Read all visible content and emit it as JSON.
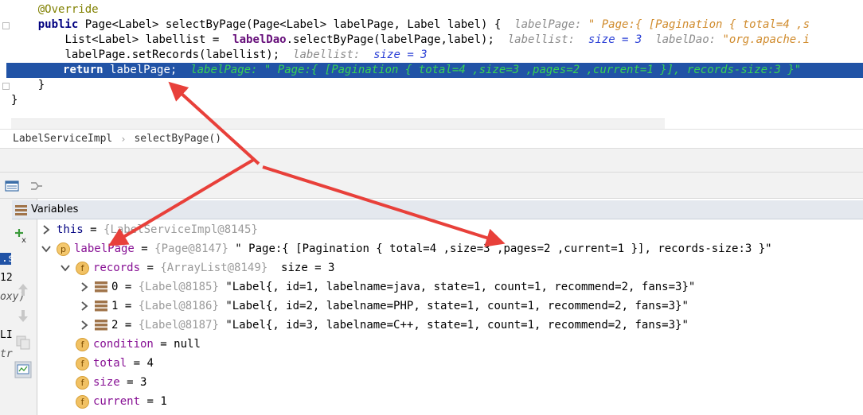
{
  "editor": {
    "lines": [
      {
        "indent": "    ",
        "parts": [
          {
            "cls": "ann",
            "text": "@Override"
          }
        ]
      },
      {
        "indent": "    ",
        "parts": [
          {
            "cls": "kw",
            "text": "public "
          },
          {
            "cls": "",
            "text": "Page<Label> selectByPage(Page<Label> labelPage, Label label) {  "
          },
          {
            "cls": "hint",
            "text": "labelPage: "
          },
          {
            "cls": "hint-str",
            "text": "\" Page:{ [Pagination { total=4 ,s"
          }
        ]
      },
      {
        "indent": "        ",
        "parts": [
          {
            "cls": "",
            "text": "List<Label> labellist =  "
          },
          {
            "cls": "fld",
            "text": "labelDao"
          },
          {
            "cls": "",
            "text": ".selectByPage(labelPage,label);  "
          },
          {
            "cls": "hint",
            "text": "labellist:  "
          },
          {
            "cls": "hint-num",
            "text": "size = 3"
          },
          {
            "cls": "hint",
            "text": "  labelDao: "
          },
          {
            "cls": "hint-str",
            "text": "\"org.apache.i"
          }
        ]
      },
      {
        "indent": "        ",
        "parts": [
          {
            "cls": "",
            "text": "labelPage.setRecords(labellist);  "
          },
          {
            "cls": "hint",
            "text": "labellist:  "
          },
          {
            "cls": "hint-num",
            "text": "size = 3"
          }
        ]
      },
      {
        "indent": "        ",
        "selected": true,
        "parts": [
          {
            "cls": "kw",
            "text": "return "
          },
          {
            "cls": "",
            "text": "labelPage;  "
          },
          {
            "cls": "hint-sel",
            "text": "labelPage: \" Page:{ [Pagination { total=4 ,size=3 ,pages=2 ,current=1 }], records-size:3 }\""
          }
        ]
      },
      {
        "indent": "    ",
        "parts": [
          {
            "cls": "",
            "text": "}"
          }
        ]
      },
      {
        "indent": "",
        "parts": [
          {
            "cls": "",
            "text": "}"
          }
        ]
      }
    ]
  },
  "breadcrumb": {
    "class_name": "LabelServiceImpl",
    "method_name": "selectByPage()"
  },
  "side_fragments": [
    {
      "text": ".s",
      "color": "#ffffff",
      "bg": "#2153a6"
    },
    {
      "text": "12",
      "color": "#000000",
      "bg": ""
    },
    {
      "text": "oxy)",
      "color": "#555555",
      "bg": "",
      "italic": true
    },
    {
      "text": "LI",
      "color": "#000000",
      "bg": ""
    },
    {
      "text": "tr",
      "color": "#555555",
      "bg": "",
      "italic": true
    }
  ],
  "variables": {
    "header_label": "Variables",
    "rows": [
      {
        "level": 0,
        "arrow": "right",
        "icon": "none",
        "name": "this",
        "name_cls": "this",
        "ref": "{LabelServiceImpl@8145}",
        "value": ""
      },
      {
        "level": 0,
        "arrow": "down",
        "icon": "p",
        "name": "labelPage",
        "name_cls": "",
        "ref": "{Page@8147}",
        "value": " \" Page:{ [Pagination { total=4 ,size=3 ,pages=2 ,current=1 }], records-size:3 }\""
      },
      {
        "level": 1,
        "arrow": "down",
        "icon": "f",
        "name": "records",
        "name_cls": "",
        "ref": "{ArrayList@8149}",
        "value": "  size = 3"
      },
      {
        "level": 2,
        "arrow": "right",
        "icon": "arr",
        "name": "0",
        "name_cls": "plain",
        "ref": "{Label@8185}",
        "value": " \"Label{, id=1, labelname=java, state=1, count=1, recommend=2, fans=3}\""
      },
      {
        "level": 2,
        "arrow": "right",
        "icon": "arr",
        "name": "1",
        "name_cls": "plain",
        "ref": "{Label@8186}",
        "value": " \"Label{, id=2, labelname=PHP, state=1, count=1, recommend=2, fans=3}\""
      },
      {
        "level": 2,
        "arrow": "right",
        "icon": "arr",
        "name": "2",
        "name_cls": "plain",
        "ref": "{Label@8187}",
        "value": " \"Label{, id=3, labelname=C++, state=1, count=1, recommend=2, fans=3}\""
      },
      {
        "level": 1,
        "arrow": "none",
        "icon": "f",
        "name": "condition",
        "name_cls": "",
        "ref": "",
        "value": "null"
      },
      {
        "level": 1,
        "arrow": "none",
        "icon": "f",
        "name": "total",
        "name_cls": "",
        "ref": "",
        "value": "4"
      },
      {
        "level": 1,
        "arrow": "none",
        "icon": "f",
        "name": "size",
        "name_cls": "",
        "ref": "",
        "value": "3"
      },
      {
        "level": 1,
        "arrow": "none",
        "icon": "f",
        "name": "current",
        "name_cls": "",
        "ref": "",
        "value": "1"
      }
    ]
  },
  "colors": {
    "selection": "#2153a6",
    "annotation_arrow": "#e8403a",
    "field_badge": "#f1c163"
  }
}
